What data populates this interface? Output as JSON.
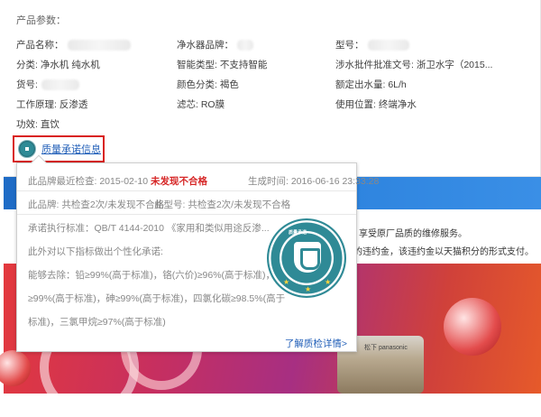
{
  "params": {
    "title": "产品参数：",
    "rows": [
      [
        "产品名称：",
        "净水器品牌：",
        "型号："
      ],
      [
        "分类: 净水机 纯水机",
        "智能类型: 不支持智能",
        "涉水批件批准文号: 浙卫水字（2015..."
      ],
      [
        "货号:",
        "颜色分类: 褐色",
        "额定出水量: 6L/h"
      ],
      [
        "工作原理: 反渗透",
        "滤芯: RO膜",
        "使用位置: 终端净水"
      ],
      [
        "功效: 直饮",
        "",
        ""
      ]
    ],
    "quality_link": "质量承诺信息"
  },
  "popup": {
    "inspection_prefix": "此品牌最近检查: 2015-02-10",
    "inspection_result": "未发现不合格",
    "generated": "生成时间: 2016-06-16 23:33:28",
    "brand_checks": "此品牌: 共检查2次/未发现不合格",
    "model_checks": "此型号: 共检查2次/未发现不合格",
    "standard": "承诺执行标准：QB/T 4144-2010 《家用和类似用途反渗...",
    "extra": "此外对以下指标做出个性化承诺:",
    "removal_1": "能够去除：铅≥99%(高于标准)，铬(六价)≥96%(高于标准)，镉",
    "removal_2": "≥99%(高于标准)，砷≥99%(高于标准)，四氯化碳≥98.5%(高于",
    "removal_3": "标准)，三氯甲烷≥97%(高于标准)",
    "more": "了解质检详情>",
    "seal_text": "质量承诺"
  },
  "promo": {
    "service": "享受原厂品质的维修服务。",
    "penalty": "的违约金，该违约金以天猫积分的形式支付。",
    "product_brand": "松下 panasonic"
  },
  "colors": {
    "accent_red": "#d62727",
    "link_blue": "#2461b9",
    "seal_teal": "#2f8a96"
  }
}
